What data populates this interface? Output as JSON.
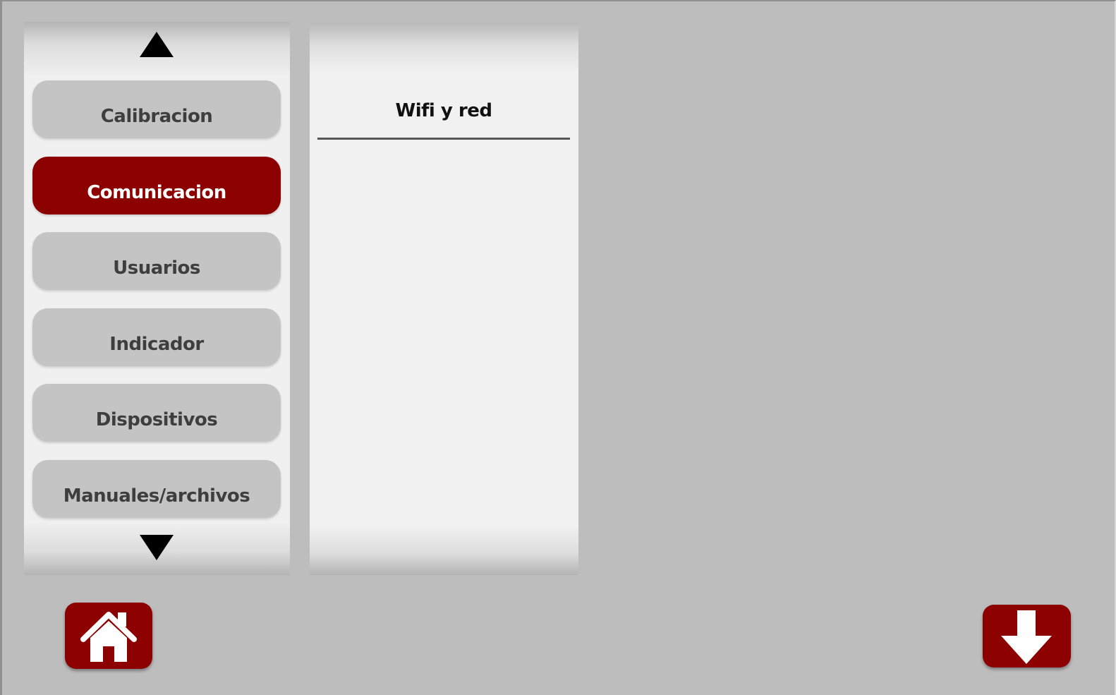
{
  "menu": {
    "items": [
      {
        "label": "Calibracion",
        "active": false
      },
      {
        "label": "Comunicacion",
        "active": true
      },
      {
        "label": "Usuarios",
        "active": false
      },
      {
        "label": "Indicador",
        "active": false
      },
      {
        "label": "Dispositivos",
        "active": false
      },
      {
        "label": "Manuales/archivos",
        "active": false
      }
    ],
    "scroll_up_icon": "triangle-up-icon",
    "scroll_down_icon": "triangle-down-icon"
  },
  "submenu": {
    "items": [
      {
        "label": "Wifi y red"
      }
    ]
  },
  "footer": {
    "home_icon": "home-icon",
    "download_icon": "arrow-down-icon"
  },
  "colors": {
    "background": "#bdbdbd",
    "panel": "#f0f0f0",
    "button": "#c4c4c4",
    "accent": "#8c0000",
    "button_text": "#3e3e3e",
    "active_text": "#ffffff"
  }
}
